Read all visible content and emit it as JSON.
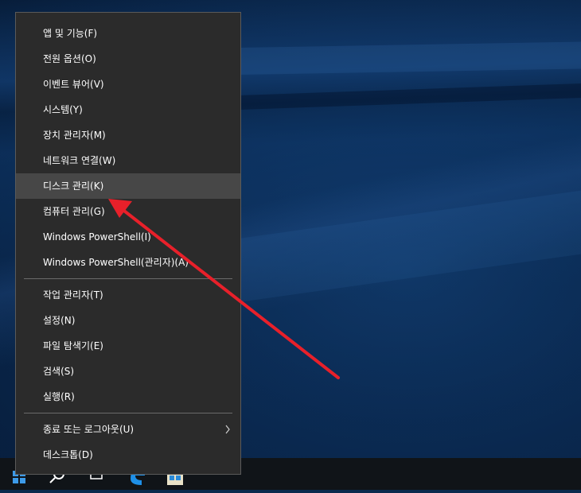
{
  "menu": {
    "items": [
      {
        "label": "앱 및 기능(F)"
      },
      {
        "label": "전원 옵션(O)"
      },
      {
        "label": "이벤트 뷰어(V)"
      },
      {
        "label": "시스템(Y)"
      },
      {
        "label": "장치 관리자(M)"
      },
      {
        "label": "네트워크 연결(W)"
      },
      {
        "label": "디스크 관리(K)",
        "highlighted": true
      },
      {
        "label": "컴퓨터 관리(G)"
      },
      {
        "label": "Windows PowerShell(I)"
      },
      {
        "label": "Windows PowerShell(관리자)(A)"
      },
      {
        "label": "작업 관리자(T)"
      },
      {
        "label": "설정(N)"
      },
      {
        "label": "파일 탐색기(E)"
      },
      {
        "label": "검색(S)"
      },
      {
        "label": "실행(R)"
      },
      {
        "label": "종료 또는 로그아웃(U)",
        "has_submenu": true
      },
      {
        "label": "데스크톱(D)"
      }
    ]
  },
  "colors": {
    "menu_bg": "#2b2b2b",
    "menu_hover": "#474747",
    "annotation_arrow": "#e8202a",
    "taskbar": "#101418"
  },
  "taskbar": {
    "icons": [
      "windows-start-icon",
      "search-icon",
      "task-view-icon",
      "edge-browser-icon",
      "store-icon"
    ]
  }
}
